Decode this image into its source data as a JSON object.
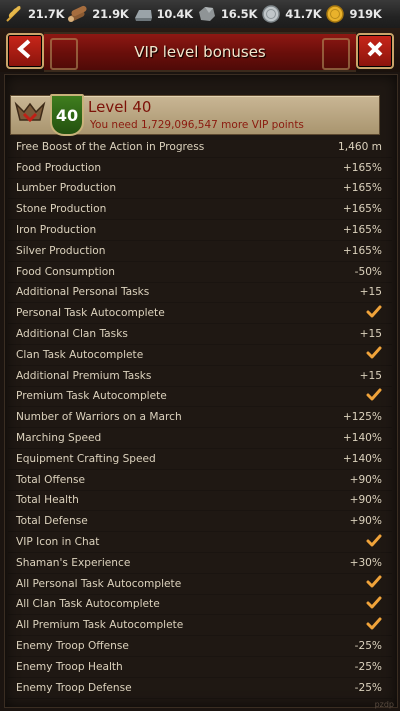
{
  "resources": [
    {
      "icon": "wheat-icon",
      "value": "21.7K"
    },
    {
      "icon": "wood-logs-icon",
      "value": "21.9K"
    },
    {
      "icon": "iron-ingot-icon",
      "value": "10.4K"
    },
    {
      "icon": "stone-icon",
      "value": "16.5K"
    },
    {
      "icon": "silver-coin-icon",
      "value": "41.7K"
    },
    {
      "icon": "gold-coin-icon",
      "value": "919K"
    }
  ],
  "header": {
    "title": "VIP level bonuses",
    "back_icon": "back-arrow-icon",
    "close_icon": "close-x-icon"
  },
  "level": {
    "badge_number": "40",
    "name": "Level 40",
    "subtitle": "You need 1,729,096,547 more VIP points"
  },
  "bonuses": [
    {
      "label": "Free Boost of the Action in Progress",
      "value": "1,460 m"
    },
    {
      "label": "Food Production",
      "value": "+165%"
    },
    {
      "label": "Lumber Production",
      "value": "+165%"
    },
    {
      "label": "Stone Production",
      "value": "+165%"
    },
    {
      "label": "Iron Production",
      "value": "+165%"
    },
    {
      "label": "Silver Production",
      "value": "+165%"
    },
    {
      "label": "Food Consumption",
      "value": "-50%"
    },
    {
      "label": "Additional Personal Tasks",
      "value": "+15"
    },
    {
      "label": "Personal Task Autocomplete",
      "value": "check"
    },
    {
      "label": "Additional Clan Tasks",
      "value": "+15"
    },
    {
      "label": "Clan Task Autocomplete",
      "value": "check"
    },
    {
      "label": "Additional Premium Tasks",
      "value": "+15"
    },
    {
      "label": "Premium Task Autocomplete",
      "value": "check"
    },
    {
      "label": "Number of Warriors on a March",
      "value": "+125%"
    },
    {
      "label": "Marching Speed",
      "value": "+140%"
    },
    {
      "label": "Equipment Crafting Speed",
      "value": "+140%"
    },
    {
      "label": "Total Offense",
      "value": "+90%"
    },
    {
      "label": "Total Health",
      "value": "+90%"
    },
    {
      "label": "Total Defense",
      "value": "+90%"
    },
    {
      "label": "VIP Icon in Chat",
      "value": "check"
    },
    {
      "label": "Shaman's Experience",
      "value": "+30%"
    },
    {
      "label": "All Personal Task Autocomplete",
      "value": "check"
    },
    {
      "label": "All Clan Task Autocomplete",
      "value": "check"
    },
    {
      "label": "All Premium Task Autocomplete",
      "value": "check"
    },
    {
      "label": "Enemy Troop Offense",
      "value": "-25%"
    },
    {
      "label": "Enemy Troop Health",
      "value": "-25%"
    },
    {
      "label": "Enemy Troop Defense",
      "value": "-25%"
    }
  ],
  "colors": {
    "accent_red": "#8e1813",
    "check_orange": "#f0a33a",
    "level_text": "#7c1108",
    "badge_green": "#3f7d1e"
  }
}
